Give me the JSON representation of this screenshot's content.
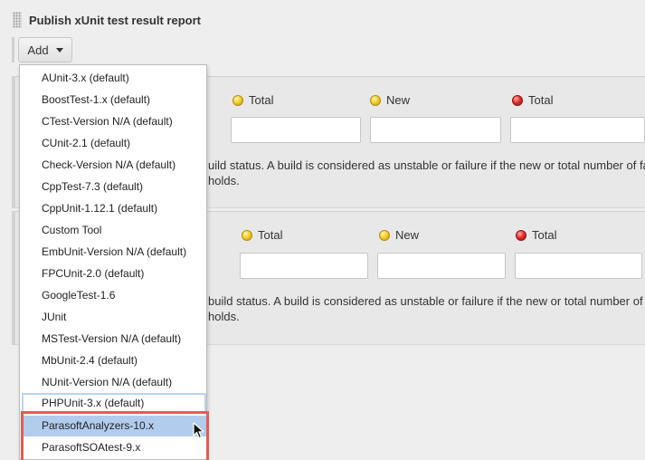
{
  "section": {
    "title": "Publish xUnit test result report",
    "add_button_label": "Add"
  },
  "block1": {
    "labels": {
      "total_yellow": "Total",
      "new_yellow": "New",
      "total_red": "Total"
    },
    "help_line1": "uild status. A build is considered as unstable or failure if the new or total number of fai",
    "help_line2": "holds."
  },
  "block2": {
    "labels": {
      "total_yellow": "Total",
      "new_yellow": "New",
      "total_red": "Total"
    },
    "help_line1": "build status. A build is considered as unstable or failure if the new or total number of",
    "help_line2": "holds."
  },
  "menu": {
    "items": [
      "AUnit-3.x (default)",
      "BoostTest-1.x (default)",
      "CTest-Version N/A (default)",
      "CUnit-2.1 (default)",
      "Check-Version N/A (default)",
      "CppTest-7.3 (default)",
      "CppUnit-1.12.1 (default)",
      "Custom Tool",
      "EmbUnit-Version N/A (default)",
      "FPCUnit-2.0 (default)",
      "GoogleTest-1.6",
      "JUnit",
      "MSTest-Version N/A (default)",
      "MbUnit-2.4 (default)",
      "NUnit-Version N/A (default)",
      "PHPUnit-3.x (default)",
      "ParasoftAnalyzers-10.x",
      "ParasoftSOAtest-9.x"
    ],
    "hovered_item": "ParasoftAnalyzers-10.x",
    "focused_item": "PHPUnit-3.x (default)"
  },
  "colors": {
    "warning_dot": "#f5cf2a",
    "error_dot": "#e8302a",
    "highlight_border": "#ea5a4a",
    "hover_background": "#b2ccee"
  },
  "icons": {
    "drag_handle": "drag-handle-icon",
    "caret": "caret-down-icon",
    "warning": "yellow-ball-icon",
    "error": "red-ball-icon",
    "cursor": "mouse-pointer-icon"
  }
}
